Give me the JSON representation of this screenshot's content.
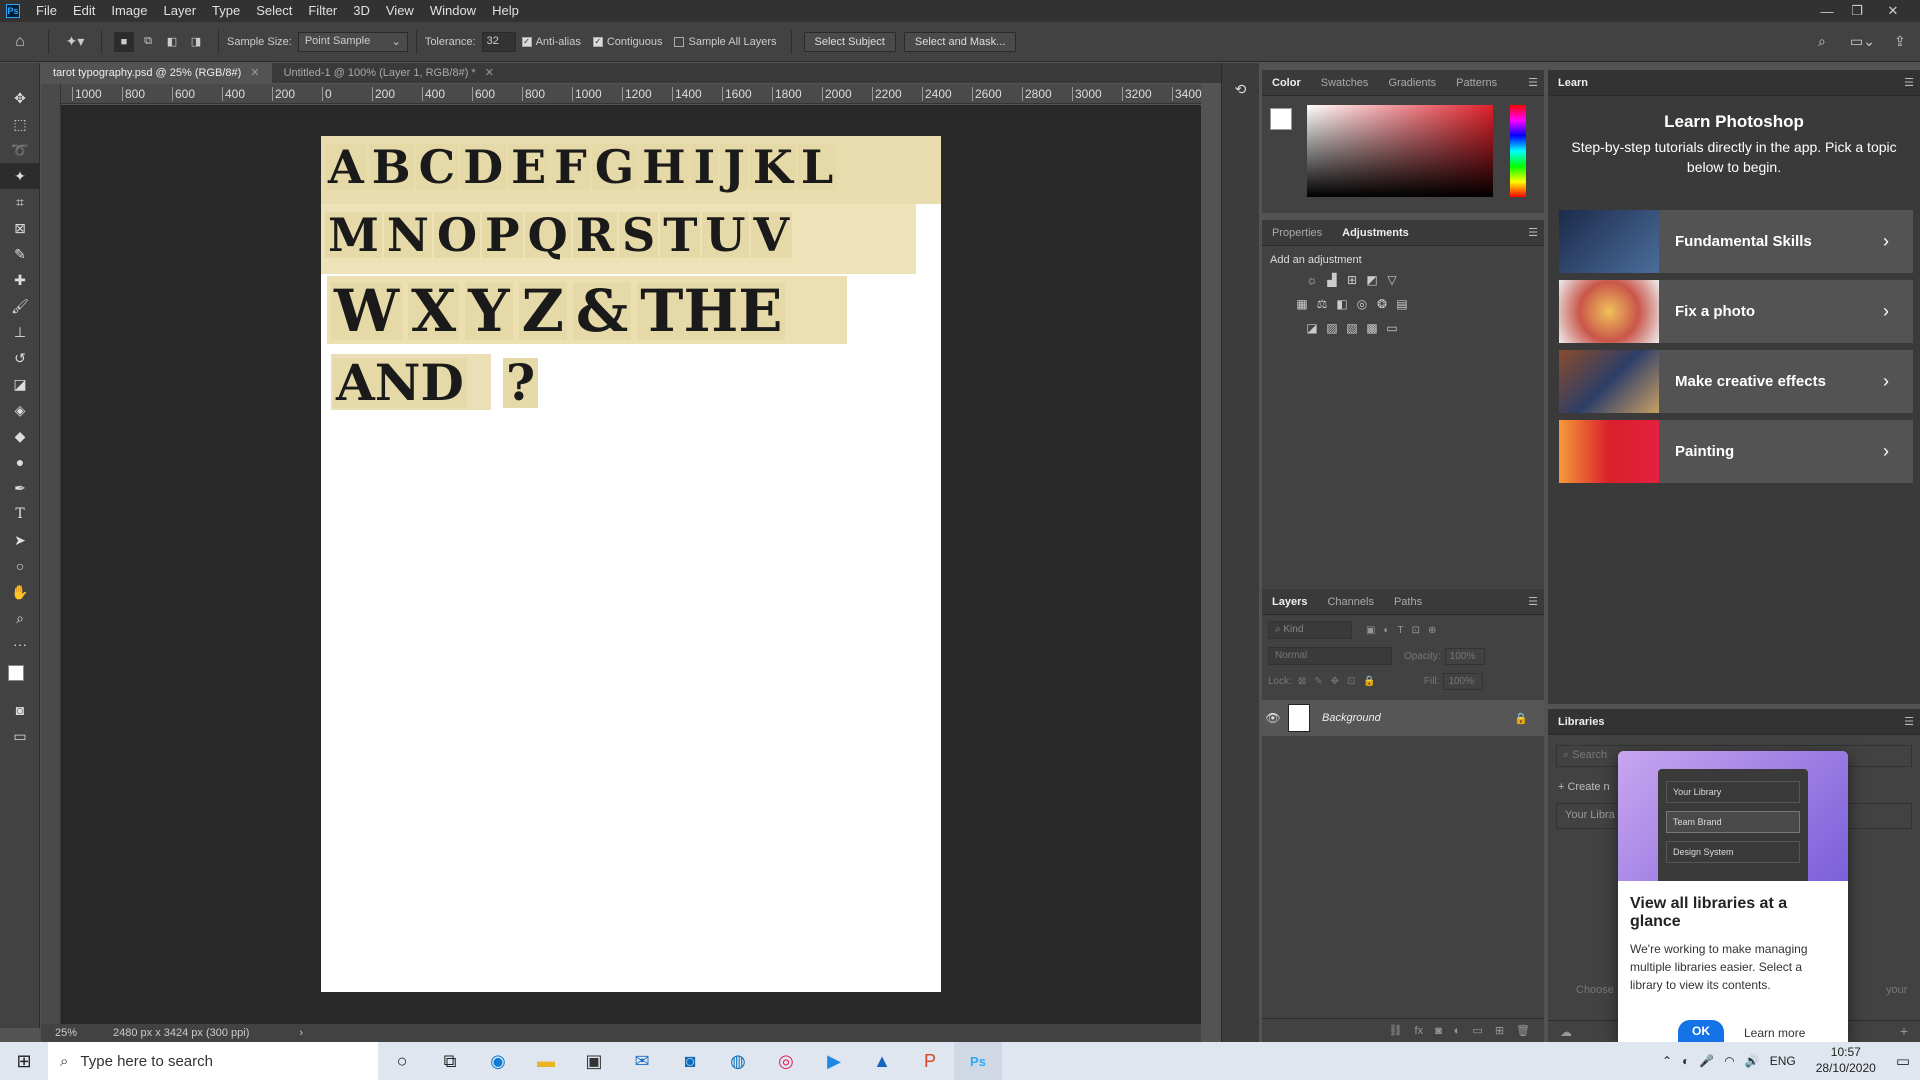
{
  "menu": {
    "logo": "Ps",
    "items": [
      "File",
      "Edit",
      "Image",
      "Layer",
      "Type",
      "Select",
      "Filter",
      "3D",
      "View",
      "Window",
      "Help"
    ]
  },
  "options": {
    "sample_size_label": "Sample Size:",
    "sample_size_value": "Point Sample",
    "tolerance_label": "Tolerance:",
    "tolerance_value": "32",
    "anti_alias": "Anti-alias",
    "contiguous": "Contiguous",
    "sample_all_layers": "Sample All Layers",
    "select_subject": "Select Subject",
    "select_and_mask": "Select and Mask..."
  },
  "tabs": [
    {
      "label": "tarot typography.psd @ 25% (RGB/8#)"
    },
    {
      "label": "Untitled-1 @ 100% (Layer 1, RGB/8#) *"
    }
  ],
  "ruler": {
    "ticks": [
      "1000",
      "800",
      "600",
      "400",
      "200",
      "0",
      "200",
      "400",
      "600",
      "800",
      "1000",
      "1200",
      "1400",
      "1600",
      "1800",
      "2000",
      "2200",
      "2400",
      "2600",
      "2800",
      "3000",
      "3200",
      "3400"
    ]
  },
  "artwork": {
    "row1": [
      "A",
      "B",
      "C",
      "D",
      "E",
      "F",
      "G",
      "H",
      "I",
      "J",
      "K",
      "L"
    ],
    "row2": [
      "M",
      "N",
      "O",
      "P",
      "Q",
      "R",
      "S",
      "T",
      "U",
      "V"
    ],
    "row3": [
      "W",
      "X",
      "Y",
      "Z",
      "&",
      "THE"
    ],
    "row4": [
      "AND",
      "?"
    ]
  },
  "status": {
    "zoom": "25%",
    "dims": "2480 px x 3424 px (300 ppi)"
  },
  "color_panel": {
    "tabs": [
      "Color",
      "Swatches",
      "Gradients",
      "Patterns"
    ]
  },
  "adjust_panel": {
    "tabs": [
      "Properties",
      "Adjustments"
    ],
    "hint": "Add an adjustment"
  },
  "layers_panel": {
    "tabs": [
      "Layers",
      "Channels",
      "Paths"
    ],
    "kind": "Kind",
    "blend": "Normal",
    "opacity_label": "Opacity:",
    "opacity": "100%",
    "lock_label": "Lock:",
    "fill_label": "Fill:",
    "fill": "100%",
    "layer_name": "Background"
  },
  "learn": {
    "tab": "Learn",
    "title": "Learn Photoshop",
    "subtitle": "Step-by-step tutorials directly in the app. Pick a topic below to begin.",
    "cards": [
      "Fundamental Skills",
      "Fix a photo",
      "Make creative effects",
      "Painting"
    ]
  },
  "libraries": {
    "tab": "Libraries",
    "search": "Search",
    "create": "+ Create n",
    "your_libs": "Your Libra",
    "choose": "Choose",
    "your": "your",
    "popup": {
      "opt1": "Your Library",
      "opt2": "Team Brand",
      "opt3": "Design System",
      "title": "View all libraries at a glance",
      "body": "We're working to make managing multiple libraries easier. Select a library to view its contents.",
      "ok": "OK",
      "learn_more": "Learn more"
    }
  },
  "taskbar": {
    "search_placeholder": "Type here to search",
    "lang": "ENG",
    "time": "10:57",
    "date": "28/10/2020"
  },
  "colors": {
    "accent": "#1473e6",
    "panel": "#424242",
    "dark": "#323232"
  }
}
